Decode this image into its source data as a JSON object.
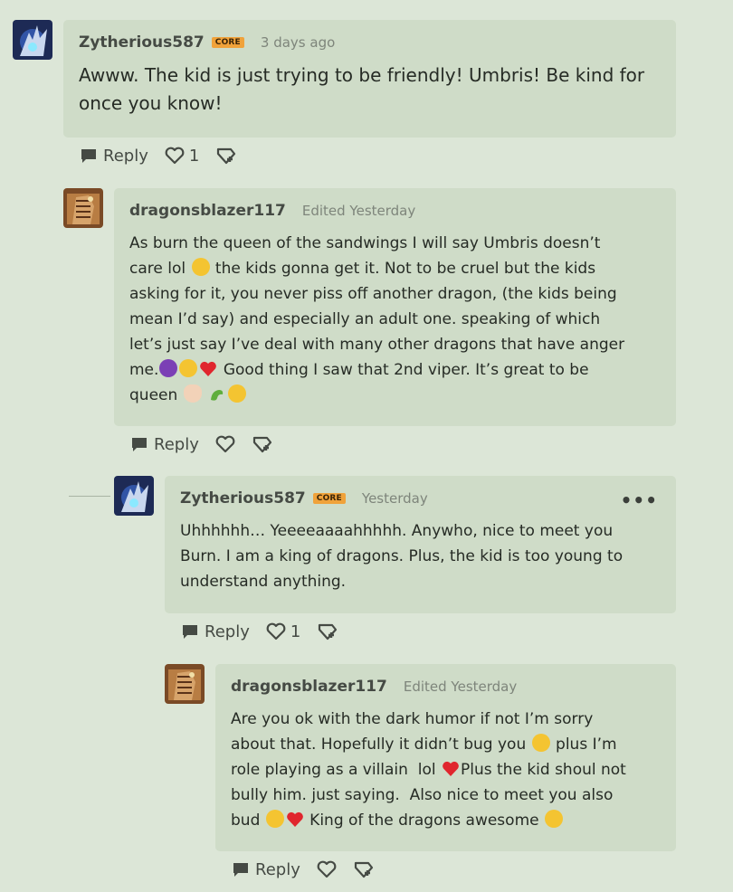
{
  "comments": [
    {
      "username": "Zytherious587",
      "badge": "CORE",
      "meta": "3 days ago",
      "text": "Awww. The kid is just trying to be friendly! Umbris! Be kind for once you know!",
      "reply_label": "Reply",
      "like_count": "1"
    },
    {
      "username": "dragonsblazer117",
      "meta": "Edited Yesterday",
      "lines": [
        "As burn the queen of the sandwings I will say Umbris doesn’t",
        "care lol",
        "the kids gonna get it. Not to be cruel but the kids",
        "asking for it, you never piss off another dragon, (the kids being",
        "mean I’d say) and especially an adult one. speaking of which",
        "let’s just say I’ve deal with many other dragons that have anger",
        "me.",
        "Good thing I saw that 2nd viper. It’s great to be",
        "queen"
      ],
      "reply_label": "Reply"
    },
    {
      "username": "Zytherious587",
      "badge": "CORE",
      "meta": "Yesterday",
      "more": "•••",
      "lines": [
        "Uhhhhhh… Yeeeeaaaahhhhh. Anywho, nice to meet you",
        "Burn. I am a king of dragons. Plus, the kid is too young to",
        "understand anything."
      ],
      "reply_label": "Reply",
      "like_count": "1"
    },
    {
      "username": "dragonsblazer117",
      "meta": "Edited Yesterday",
      "lines": [
        "Are you ok with the dark humor if not I’m sorry",
        "about that. Hopefully it didn’t bug you",
        "plus I’m",
        "role playing as a villain  lol",
        "Plus the kid shoul not",
        "bully him. just saying.  Also nice to meet you also",
        "bud",
        "King of the dragons awesome"
      ],
      "reply_label": "Reply"
    }
  ],
  "colors": {
    "background": "#dce6d7",
    "bubble": "#cfdcc8",
    "badge": "#f0a23a",
    "heart_emoji": "#e0262e"
  },
  "icons": [
    "comment-bubble-icon",
    "heart-outline-icon",
    "award-icon",
    "more-dots-icon",
    "avatar-dragon-icon"
  ]
}
